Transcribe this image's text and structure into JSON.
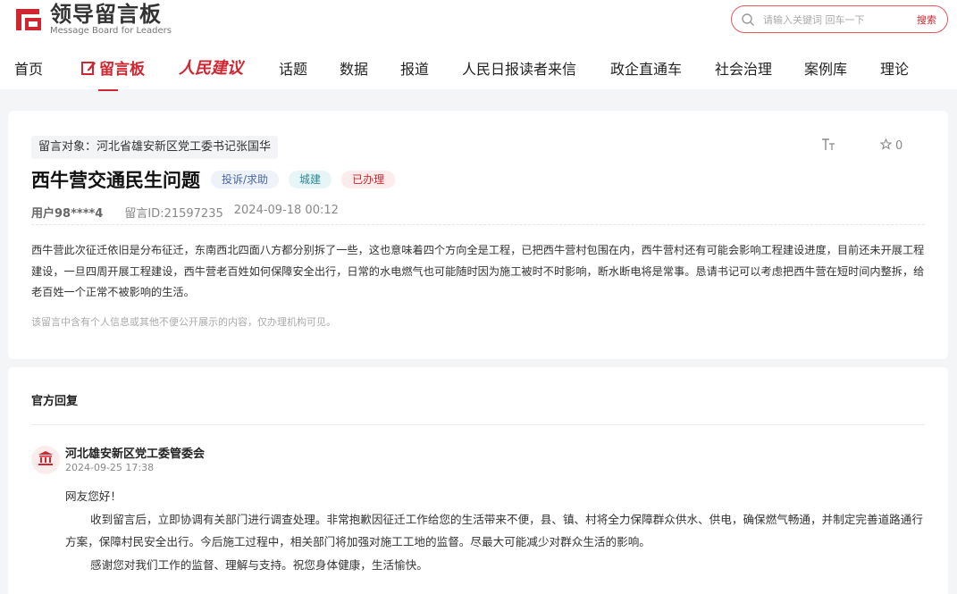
{
  "header": {
    "logo_cn": "领导留言板",
    "logo_en": "Message Board for Leaders",
    "search_placeholder": "请输入关键词 回车一下",
    "search_button": "搜索"
  },
  "nav": {
    "items": [
      "首页",
      "留言板",
      "人民建议",
      "话题",
      "数据",
      "报道",
      "人民日报读者来信",
      "政企直通车",
      "社会治理",
      "案例库",
      "理论"
    ]
  },
  "message": {
    "target": "留言对象：河北省雄安新区党工委书记张国华",
    "star_count": "0",
    "font_icon_text": "TT",
    "title": "西牛营交通民生问题",
    "tags": [
      "投诉/求助",
      "城建",
      "已办理"
    ],
    "user": "用户98****4",
    "id": "留言ID:21597235",
    "time": "2024-09-18 00:12",
    "body": "西牛营此次征迁依旧是分布征迁，东南西北四面八方都分别拆了一些，这也意味着四个方向全是工程，已把西牛营村包围在内，西牛营村还有可能会影响工程建设进度，目前还未开展工程建设，一旦四周开展工程建设，西牛营老百姓如何保障安全出行，日常的水电燃气也可能随时因为施工被时不时影响，断水断电将是常事。恳请书记可以考虑把西牛营在短时间内整拆，给老百姓一个正常不被影响的生活。",
    "note": "该留言中含有个人信息或其他不便公开展示的内容，仅办理机构可见。"
  },
  "reply": {
    "section_title": "官方回复",
    "org": "河北雄安新区党工委管委会",
    "date": "2024-09-25 17:38",
    "greeting": "网友您好！",
    "para1": "收到留言后，立即协调有关部门进行调查处理。非常抱歉因征迁工作给您的生活带来不便，县、镇、村将全力保障群众供水、供电，确保燃气畅通，并制定完善道路通行方案，保障村民安全出行。今后施工过程中，相关部门将加强对施工工地的监督。尽最大可能减少对群众生活的影响。",
    "para2": "感谢您对我们工作的监督、理解与支持。祝您身体健康，生活愉快。"
  },
  "colors": {
    "brand_red": "#d0262f",
    "page_bg": "#f4f5f7"
  }
}
